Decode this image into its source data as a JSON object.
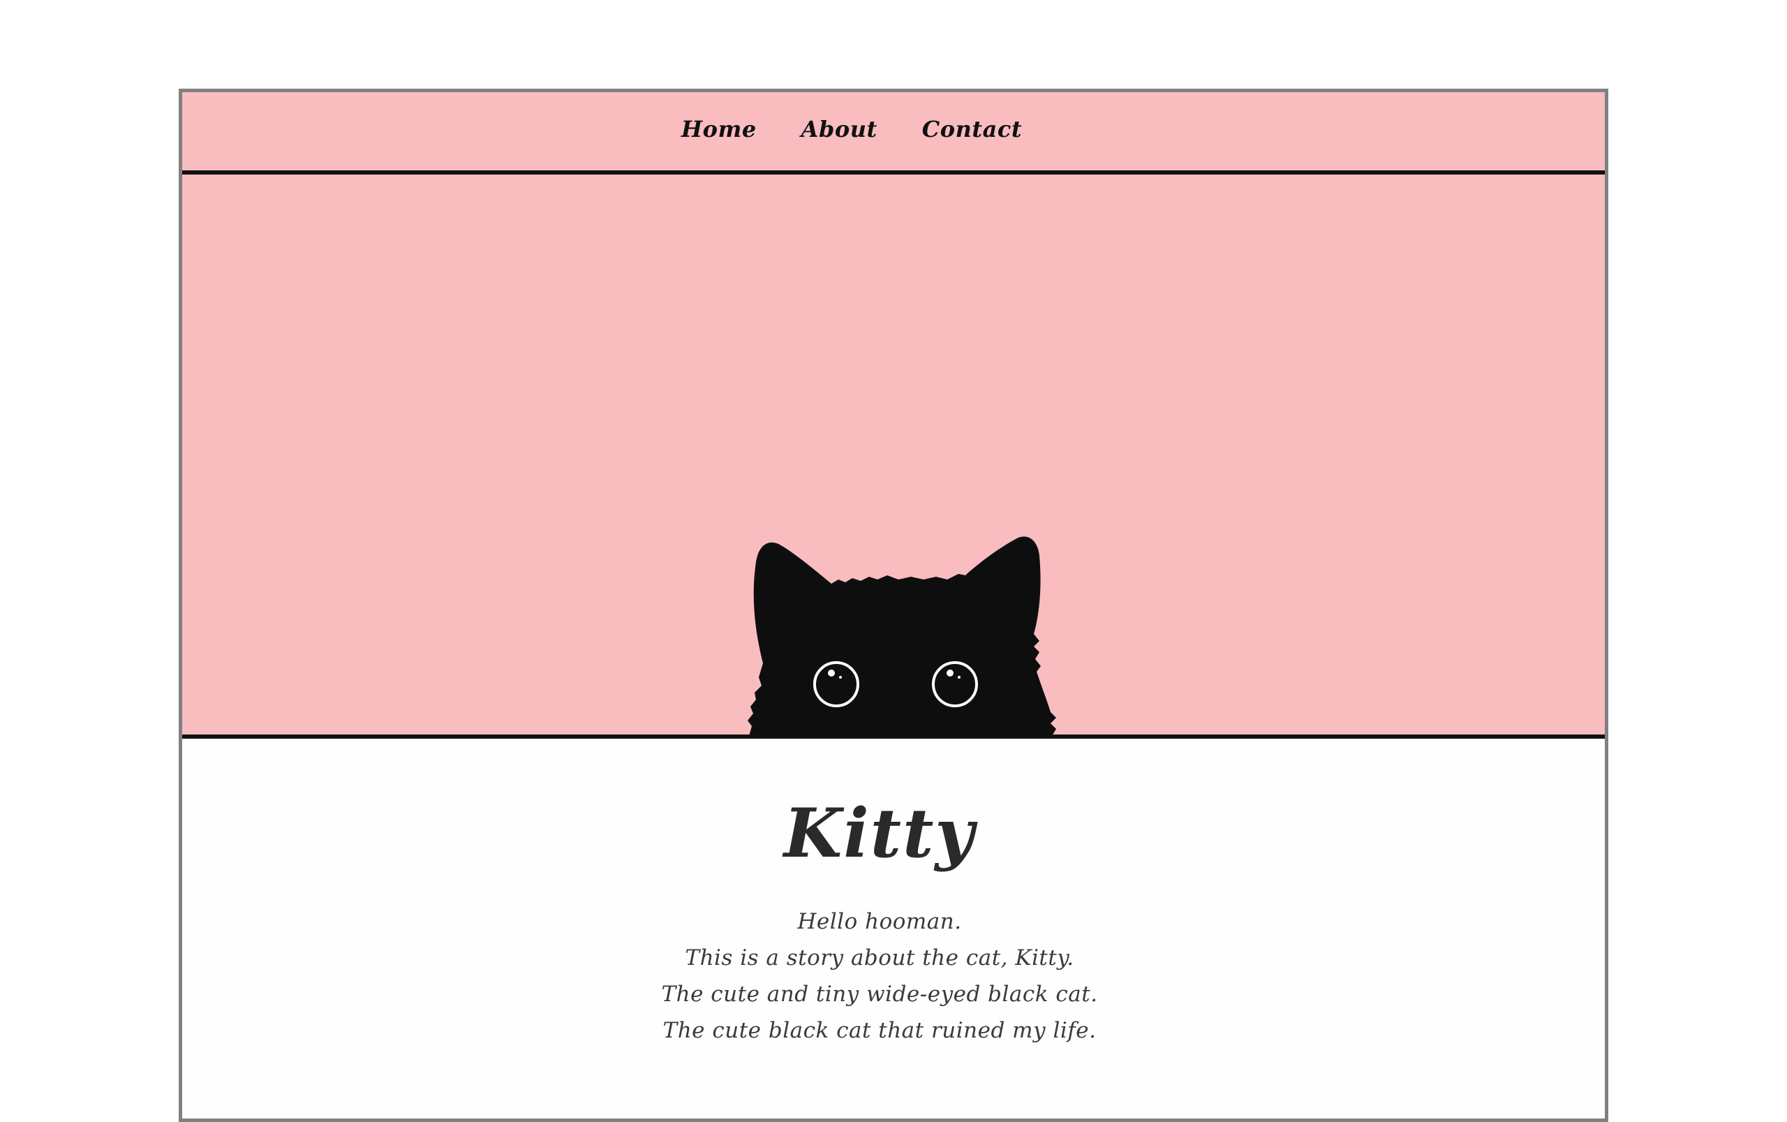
{
  "colors": {
    "pink_background": "#f9bdbf",
    "border_dark": "#111111",
    "frame_border": "#808080",
    "cat_fill": "#0e0e0f",
    "text": "#2a2a2a"
  },
  "nav": {
    "items": [
      {
        "label": "Home"
      },
      {
        "label": "About"
      },
      {
        "label": "Contact"
      }
    ]
  },
  "hero": {
    "image": "black-cat-peeking-illustration"
  },
  "main": {
    "title": "Kitty",
    "lines": [
      "Hello hooman.",
      "This is a story about the cat, Kitty.",
      "The cute and tiny wide-eyed black cat.",
      "The cute black cat that ruined my life."
    ]
  }
}
